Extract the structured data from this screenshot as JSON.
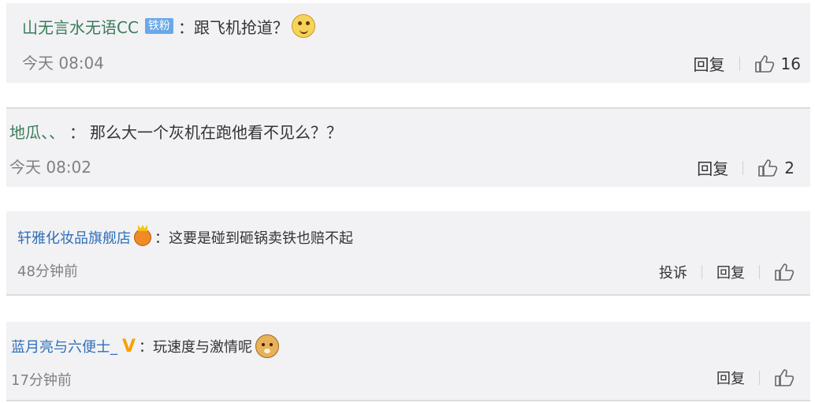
{
  "comments": [
    {
      "username": "山无言水无语CC",
      "badge": "铁粉",
      "colon": "：",
      "text": "跟飞机抢道？",
      "emoji": "smile-emoji-icon",
      "time": "今天 08:04",
      "reply_label": "回复",
      "like_count": "16"
    },
    {
      "username": "地瓜、、",
      "colon": "：",
      "text": "那么大一个灰机在跑他看不见么？？",
      "time": "今天 08:02",
      "reply_label": "回复",
      "like_count": "2"
    },
    {
      "username": "轩雅化妆品旗舰店",
      "badge_icon": "crown-badge-icon",
      "colon": "：",
      "text": "这要是碰到砸锅卖铁也赔不起",
      "time": "48分钟前",
      "report_label": "投诉",
      "reply_label": "回复"
    },
    {
      "username": "蓝月亮与六便士_",
      "vip_mark": "V",
      "colon": "：",
      "text": "玩速度与激情呢",
      "emoji": "doge-emoji-icon",
      "time": "17分钟前",
      "reply_label": "回复"
    }
  ],
  "colors": {
    "background": "#f2f2f5",
    "username_green": "#3a7c58",
    "username_blue": "#2f6fb6",
    "badge_blue": "#6aa8e8",
    "vip_gold": "#f5a300",
    "meta_gray": "#808080"
  }
}
